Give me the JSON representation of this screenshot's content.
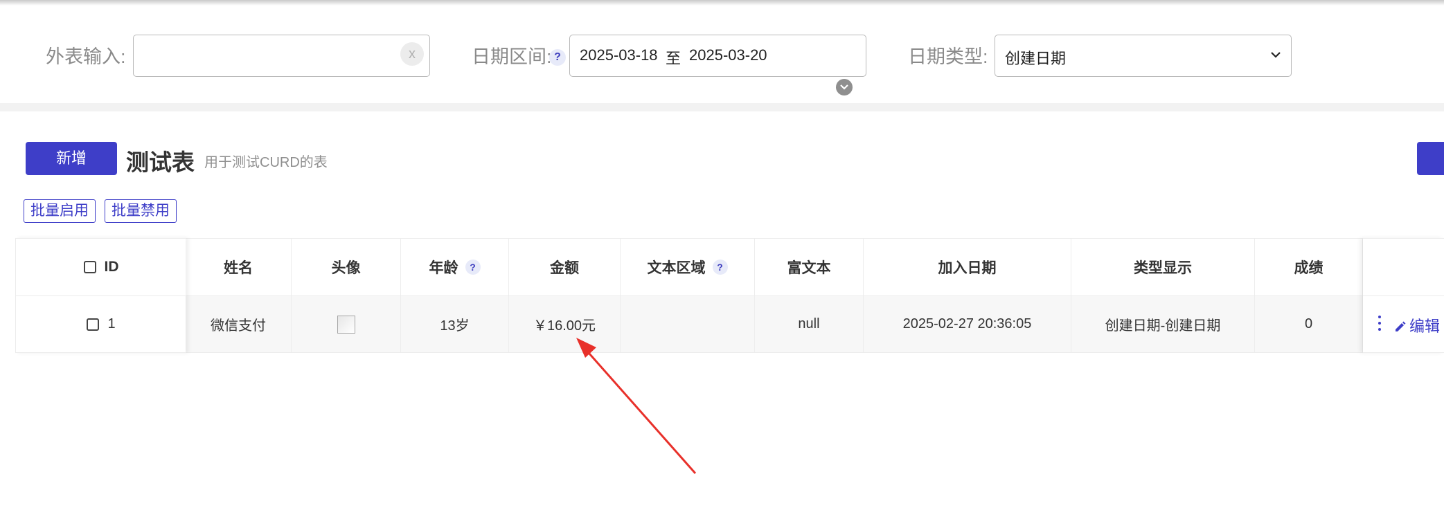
{
  "filters": {
    "foreign_label": "外表输入:",
    "foreign_value": "",
    "clear_symbol": "x",
    "date_range_label": "日期区间:",
    "help_symbol": "?",
    "date_start": "2025-03-18",
    "date_sep": "至",
    "date_end": "2025-03-20",
    "date_type_label": "日期类型:",
    "date_type_value": "创建日期"
  },
  "toolbar": {
    "add_label": "新增",
    "table_title": "测试表",
    "table_desc": "用于测试CURD的表",
    "batch_enable": "批量启用",
    "batch_disable": "批量禁用"
  },
  "table": {
    "headers": {
      "id": "ID",
      "name": "姓名",
      "avatar": "头像",
      "age": "年龄",
      "amount": "金额",
      "textarea": "文本区域",
      "richtext": "富文本",
      "join_date": "加入日期",
      "type_display": "类型显示",
      "score": "成绩"
    },
    "rows": [
      {
        "id": "1",
        "name": "微信支付",
        "age": "13岁",
        "amount": "￥16.00元",
        "textarea": "",
        "richtext": "null",
        "join_date": "2025-02-27 20:36:05",
        "type_display": "创建日期-创建日期",
        "score": "0",
        "edit_label": "编辑"
      }
    ]
  },
  "colors": {
    "primary": "#3e3ec8",
    "arrow": "#e8302a"
  }
}
